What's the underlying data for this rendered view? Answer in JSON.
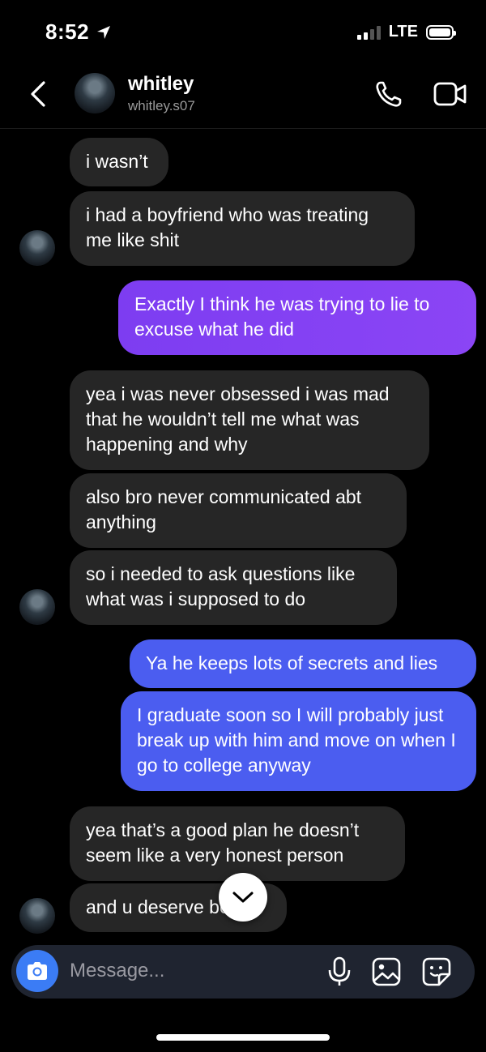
{
  "status": {
    "time": "8:52",
    "network": "LTE"
  },
  "header": {
    "name": "whitley",
    "username": "whitley.s07"
  },
  "messages": [
    {
      "text": "i wasn’t"
    },
    {
      "text": "i had a boyfriend who was treating me like shit"
    },
    {
      "text": "Exactly I think he was trying to lie to excuse what he did"
    },
    {
      "text": "yea i was never obsessed i was mad that he wouldn’t tell me what was happening and why"
    },
    {
      "text": "also bro never communicated abt anything"
    },
    {
      "text": "so i needed to ask questions like what was i supposed to do"
    },
    {
      "text": "Ya he keeps lots of secrets and lies"
    },
    {
      "text": "I graduate soon so I will probably just break up with him and move on when I go to college anyway"
    },
    {
      "text": "yea that’s a good plan he doesn’t seem like a very honest person"
    },
    {
      "text": "and u deserve better"
    }
  ],
  "composer": {
    "placeholder": "Message..."
  },
  "colors": {
    "sent_purple": "#8b45f5",
    "sent_blue": "#4b5df0",
    "received": "#262626",
    "camera": "#3b7cf5"
  }
}
